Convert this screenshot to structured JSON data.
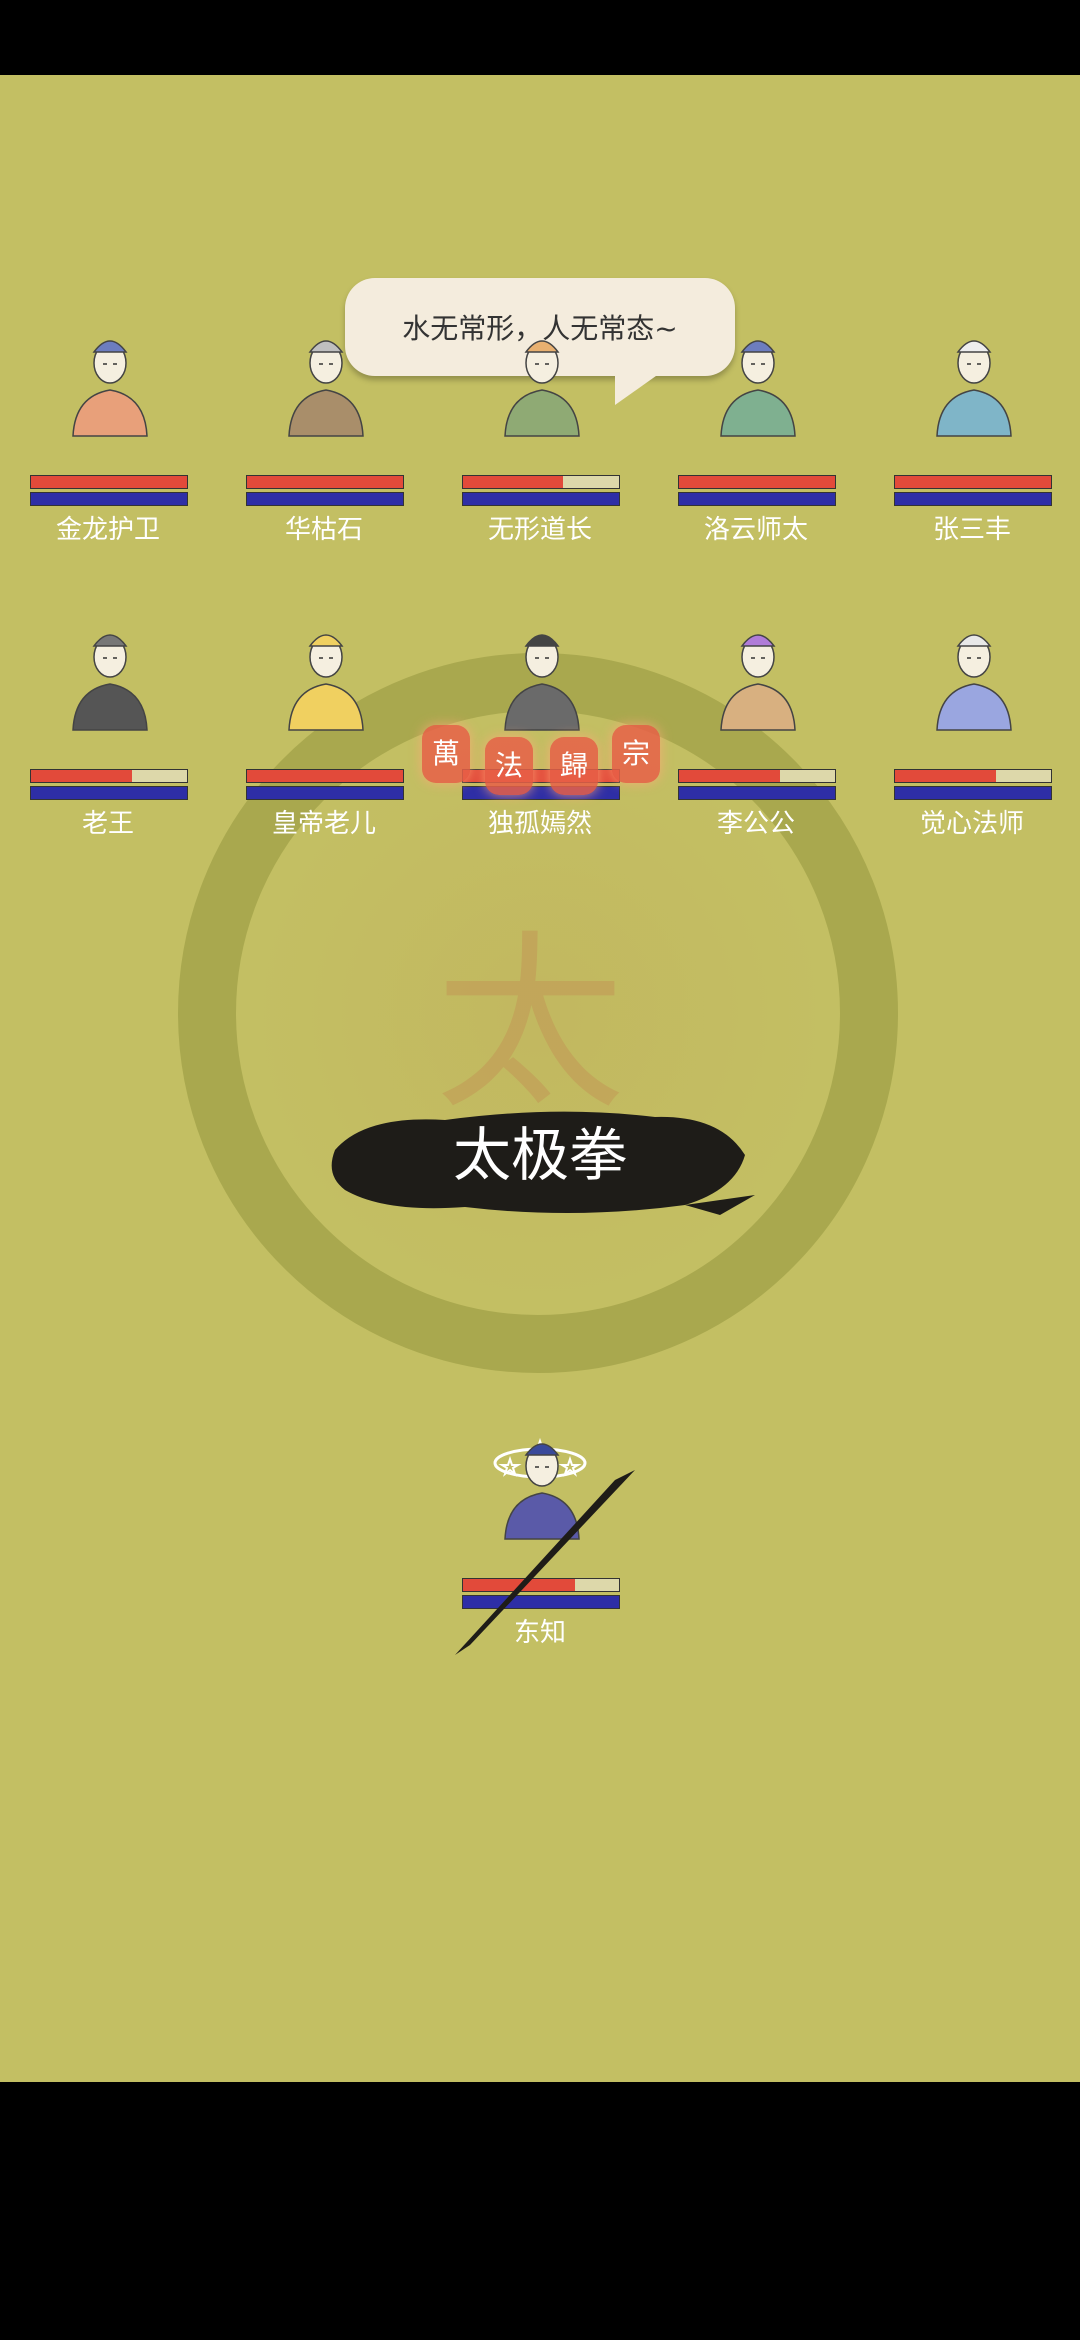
{
  "speech": {
    "text": "水无常形，人无常态~"
  },
  "background": {
    "glyph": "太"
  },
  "skill": {
    "name": "太极拳",
    "seals": [
      "萬",
      "法",
      "歸",
      "宗"
    ]
  },
  "enemies_row1": [
    {
      "name": "金龙护卫",
      "hp": 1.0,
      "mp": 1.0,
      "robe": "#e8a07a",
      "hat": "#6d7dbf"
    },
    {
      "name": "华枯石",
      "hp": 1.0,
      "mp": 1.0,
      "robe": "#a98e6a",
      "hat": "#bfbfbf"
    },
    {
      "name": "无形道长",
      "hp": 0.64,
      "mp": 1.0,
      "robe": "#8faa74",
      "hat": "#e8b070"
    },
    {
      "name": "洛云师太",
      "hp": 1.0,
      "mp": 1.0,
      "robe": "#7fb090",
      "hat": "#6d7dbf"
    },
    {
      "name": "张三丰",
      "hp": 1.0,
      "mp": 1.0,
      "robe": "#7fb5c8",
      "hat": "#eeeeee"
    }
  ],
  "enemies_row2": [
    {
      "name": "老王",
      "hp": 0.65,
      "mp": 1.0,
      "robe": "#555555",
      "hat": "#777777"
    },
    {
      "name": "皇帝老儿",
      "hp": 1.0,
      "mp": 1.0,
      "robe": "#f0d060",
      "hat": "#f0d060"
    },
    {
      "name": "独孤嫣然",
      "hp": 1.0,
      "mp": 1.0,
      "robe": "#6a6a6a",
      "hat": "#444444"
    },
    {
      "name": "李公公",
      "hp": 0.65,
      "mp": 1.0,
      "robe": "#d8b080",
      "hat": "#b07cd8"
    },
    {
      "name": "觉心法师",
      "hp": 0.65,
      "mp": 1.0,
      "robe": "#9aa6e0",
      "hat": "#e8e8e8"
    }
  ],
  "player": {
    "name": "东知",
    "hp": 0.72,
    "mp": 1.0,
    "status_icon": "dizzy-stars-icon",
    "robe": "#5a5aa8",
    "hat": "#3a4a9a"
  },
  "colors": {
    "hp": "#e24a3a",
    "mp": "#2e2ea6",
    "background": "#c3bf63"
  }
}
